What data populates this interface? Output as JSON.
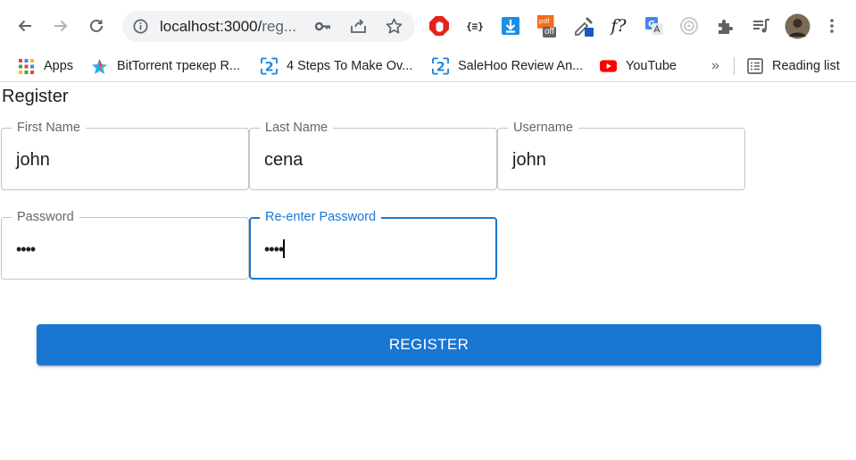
{
  "browser": {
    "url_host": "localhost:3000/",
    "url_path": "reg...",
    "accent_blue": "#1a73e8"
  },
  "bookmarks": {
    "items": [
      {
        "label": "Apps",
        "icon": "apps-grid-icon"
      },
      {
        "label": "BitTorrent трекер R...",
        "icon": "bittorrent-icon"
      },
      {
        "label": "4 Steps To Make Ov...",
        "icon": "bookmark-2-icon"
      },
      {
        "label": "SaleHoo Review An...",
        "icon": "bookmark-2-icon"
      },
      {
        "label": "YouTube",
        "icon": "youtube-icon"
      }
    ],
    "overflow_label": "»",
    "reading_list_label": "Reading list"
  },
  "extensions": {
    "json_ext_label": "{≡}",
    "pdf_badge": "off",
    "f_ext_label": "f?"
  },
  "form": {
    "title": "Register",
    "first_name": {
      "label": "First Name",
      "value": "john"
    },
    "last_name": {
      "label": "Last Name",
      "value": "cena"
    },
    "username": {
      "label": "Username",
      "value": "john"
    },
    "password": {
      "label": "Password",
      "value": "••••"
    },
    "reenter_password": {
      "label": "Re-enter Password",
      "value": "••••"
    },
    "submit_label": "REGISTER",
    "primary_color": "#1976d2"
  }
}
